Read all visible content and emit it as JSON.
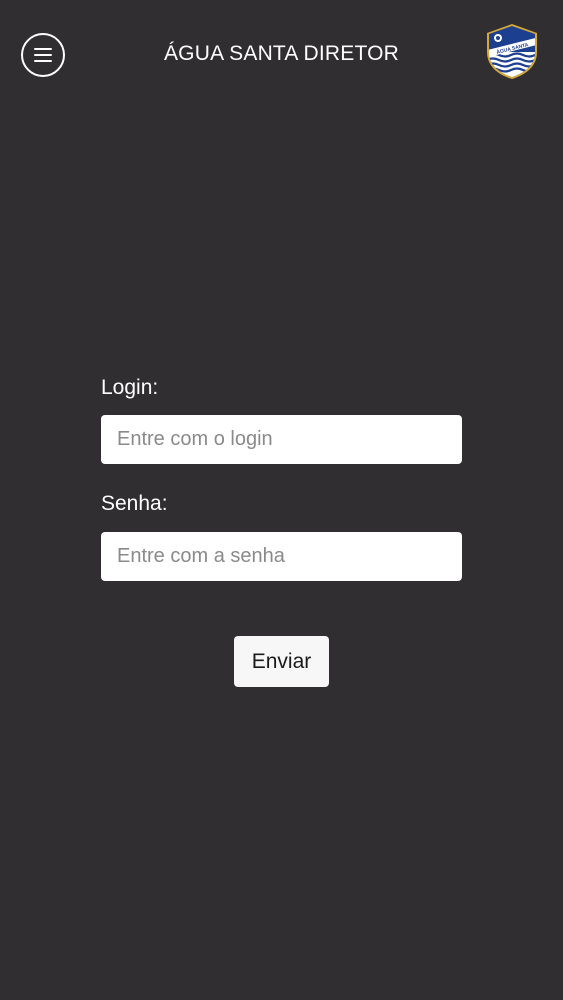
{
  "header": {
    "title": "ÁGUA SANTA DIRETOR",
    "menu_icon": "hamburger-menu-icon",
    "logo_icon": "club-crest-logo",
    "logo_text": "ÁGUA SANTA"
  },
  "login_form": {
    "login_label": "Login:",
    "login_placeholder": "Entre com o login",
    "login_value": "",
    "password_label": "Senha:",
    "password_placeholder": "Entre com a senha",
    "password_value": "",
    "submit_label": "Enviar"
  },
  "colors": {
    "background": "#302e30",
    "input_background": "#ffffff",
    "button_background": "#f7f7f7",
    "crest_blue": "#1d3f8f",
    "crest_gold": "#d4a93a"
  }
}
